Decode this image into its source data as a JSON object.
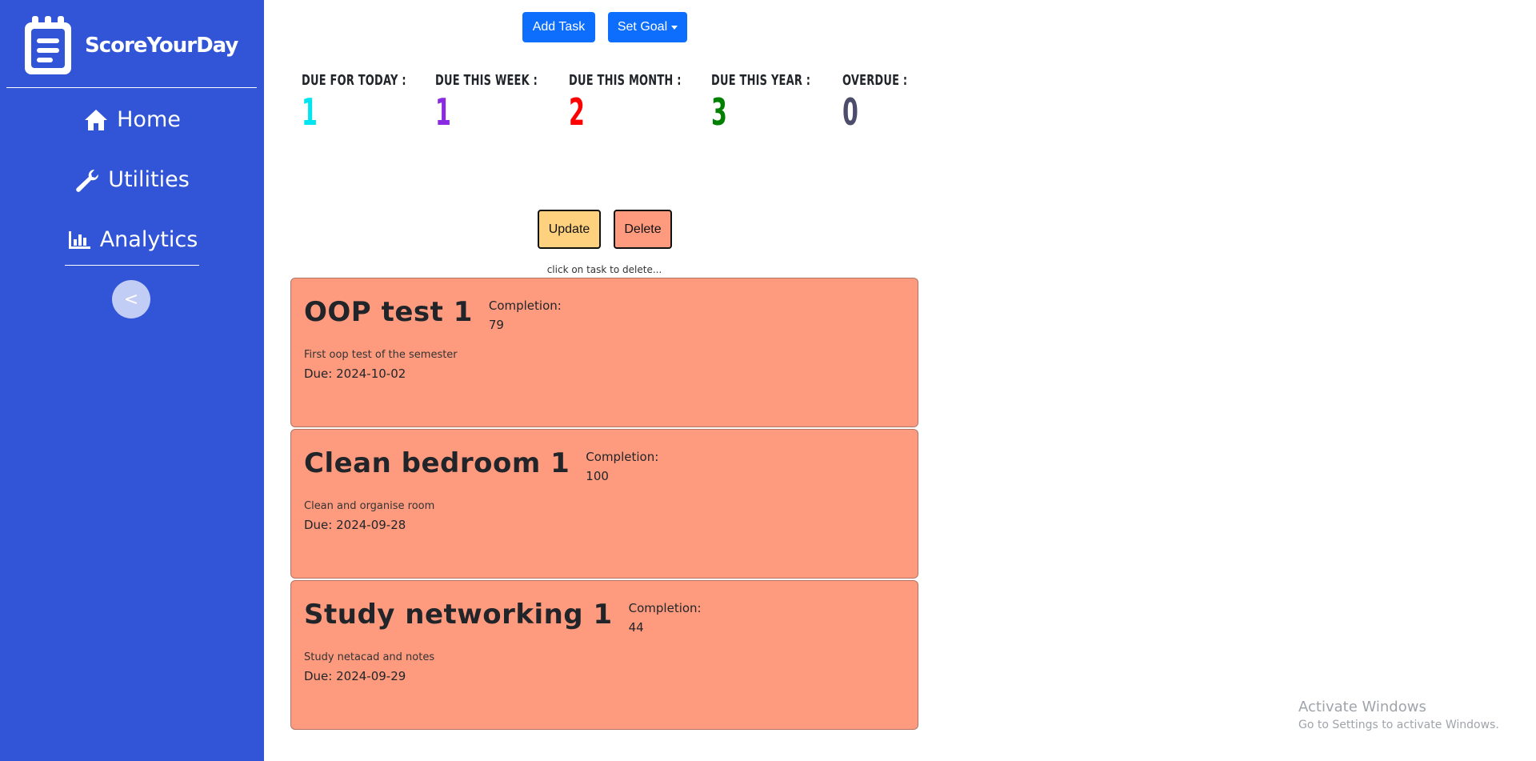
{
  "app": {
    "brand_name": "ScoreYourDay"
  },
  "sidebar": {
    "items": [
      {
        "label": "Home",
        "icon": "home-icon"
      },
      {
        "label": "Utilities",
        "icon": "wrench-icon"
      },
      {
        "label": "Analytics",
        "icon": "bar-chart-icon"
      }
    ],
    "collapse_label": "<"
  },
  "toolbar": {
    "add_task_label": "Add Task",
    "set_goal_label": "Set Goal"
  },
  "stats": [
    {
      "label": "DUE FOR TODAY :",
      "value": "1",
      "color": "#00e5ef"
    },
    {
      "label": "DUE THIS WEEK :",
      "value": "1",
      "color": "#8a2be2"
    },
    {
      "label": "DUE THIS MONTH :",
      "value": "2",
      "color": "#ff0000"
    },
    {
      "label": "DUE THIS YEAR :",
      "value": "3",
      "color": "#008000"
    },
    {
      "label": "OVERDUE :",
      "value": "0",
      "color": "#4b4d6b"
    }
  ],
  "actions": {
    "update_label": "Update",
    "delete_label": "Delete",
    "hint": "click on task to delete..."
  },
  "tasks": [
    {
      "title": "OOP test 1",
      "completion_label": "Completion:",
      "completion": "79",
      "description": "First oop test of the semester",
      "due": "Due: 2024-10-02"
    },
    {
      "title": "Clean bedroom 1",
      "completion_label": "Completion:",
      "completion": "100",
      "description": "Clean and organise room",
      "due": "Due: 2024-09-28"
    },
    {
      "title": "Study networking 1",
      "completion_label": "Completion:",
      "completion": "44",
      "description": "Study netacad and notes",
      "due": "Due: 2024-09-29"
    }
  ],
  "watermark": {
    "title": "Activate Windows",
    "subtitle": "Go to Settings to activate Windows."
  },
  "colors": {
    "sidebar": "#3155d6",
    "primary_button": "#0d6efd",
    "update_button": "#fed17f",
    "task_card": "#fe9b7f"
  }
}
